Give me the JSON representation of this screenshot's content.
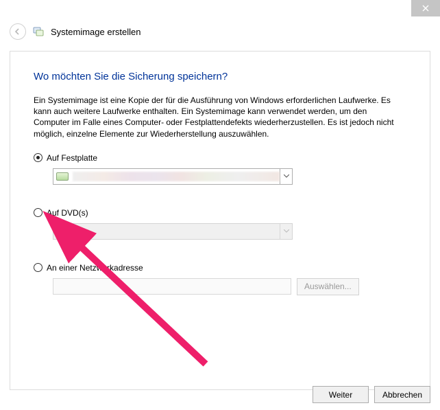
{
  "window": {
    "title": "Systemimage erstellen"
  },
  "content": {
    "heading": "Wo möchten Sie die Sicherung speichern?",
    "description": "Ein Systemimage ist eine Kopie der für die Ausführung von Windows erforderlichen Laufwerke. Es kann auch weitere Laufwerke enthalten. Ein Systemimage kann verwendet werden, um den Computer im Falle eines Computer- oder Festplattendefekts wiederherzustellen. Es ist jedoch nicht möglich, einzelne Elemente zur Wiederherstellung auszuwählen."
  },
  "options": {
    "harddisk": {
      "label": "Auf Festplatte",
      "selected": true
    },
    "dvd": {
      "label": "Auf DVD(s)",
      "selected": false
    },
    "network": {
      "label": "An einer Netzwerkadresse",
      "selected": false,
      "browse_label": "Auswählen..."
    }
  },
  "footer": {
    "next": "Weiter",
    "cancel": "Abbrechen"
  }
}
